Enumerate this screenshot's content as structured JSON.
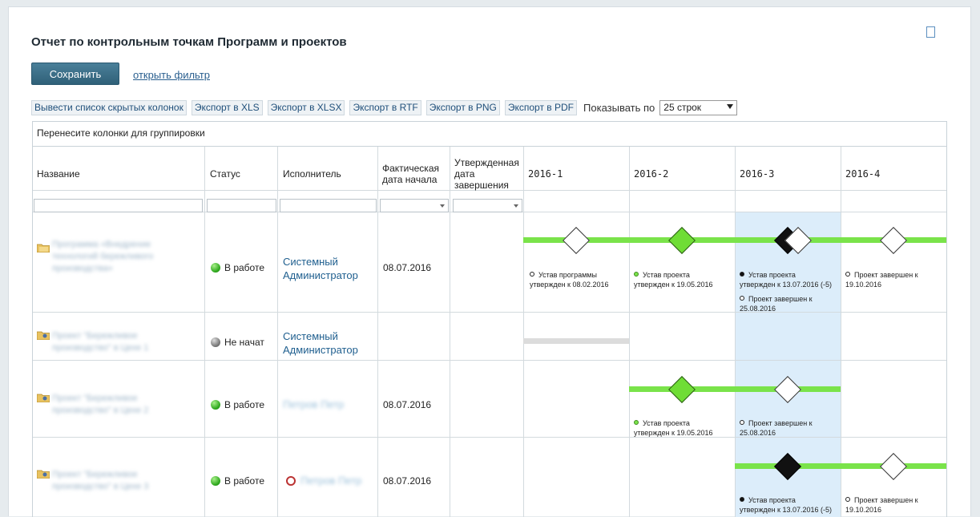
{
  "page_title": "Отчет по контрольным точкам Программ и проектов",
  "save_label": "Сохранить",
  "filter_link": "открыть фильтр",
  "toolbar": {
    "hidden_columns": "Вывести список скрытых колонок",
    "export_xls": "Экспорт в XLS",
    "export_xlsx": "Экспорт в XLSX",
    "export_rtf": "Экспорт в RTF",
    "export_png": "Экспорт в PNG",
    "export_pdf": "Экспорт в PDF",
    "show_label": "Показывать по",
    "rows_value": "25 строк"
  },
  "grid": {
    "group_hint": "Перенесите колонки для группировки",
    "columns": {
      "name": "Название",
      "status": "Статус",
      "assignee": "Исполнитель",
      "start_l1": "Фактическая",
      "start_l2": "дата начала",
      "end_l1": "Утвержденная",
      "end_l2": "дата",
      "end_l3": "завершения",
      "q1": "2016-1",
      "q2": "2016-2",
      "q3": "2016-3",
      "q4": "2016-4"
    },
    "rows": [
      {
        "name_l1": "Программа «Внедрение",
        "name_l2": "технологий бережливого",
        "name_l3": "производства»",
        "status": "В работе",
        "assignee_l1": "Системный",
        "assignee_l2": "Администратор",
        "start": "08.07.2016",
        "m1_l1": "Устав программы",
        "m1_l2": "утвержден к 08.02.2016",
        "m2_l1": "Устав проекта",
        "m2_l2": "утвержден к 19.05.2016",
        "m3_l1": "Устав проекта",
        "m3_l2": "утвержден к 13.07.2016 (-5)",
        "m3b_l1": "Проект завершен к",
        "m3b_l2": "25.08.2016",
        "m4_l1": "Проект завершен к",
        "m4_l2": "19.10.2016"
      },
      {
        "name_l1": "Проект \"Бережливое",
        "name_l2": "производство\" в Цехе 1",
        "status": "Не начат",
        "assignee_l1": "Системный",
        "assignee_l2": "Администратор"
      },
      {
        "name_l1": "Проект \"Бережливое",
        "name_l2": "производство\" в Цехе 2",
        "status": "В работе",
        "assignee": "Петров Петр",
        "start": "08.07.2016",
        "m2_l1": "Устав проекта",
        "m2_l2": "утвержден к 19.05.2016",
        "m3_l1": "Проект завершен к",
        "m3_l2": "25.08.2016"
      },
      {
        "name_l1": "Проект \"Бережливое",
        "name_l2": "производство\" в Цехе 3",
        "status": "В работе",
        "assignee": "Петров Петр",
        "start": "08.07.2016",
        "m3_l1": "Устав проекта",
        "m3_l2": "утвержден к 13.07.2016 (-5)",
        "m4_l1": "Проект завершен к",
        "m4_l2": "19.10.2016"
      }
    ]
  },
  "colors": {
    "bar_green": "#7ae34a",
    "highlight_column": "#dcedfa",
    "link_blue": "#1f5f8f"
  },
  "icons": [
    "folder-icon",
    "status-dot-icon",
    "clock-icon",
    "milestone-diamond-icon",
    "dropdown-arrow-icon"
  ]
}
